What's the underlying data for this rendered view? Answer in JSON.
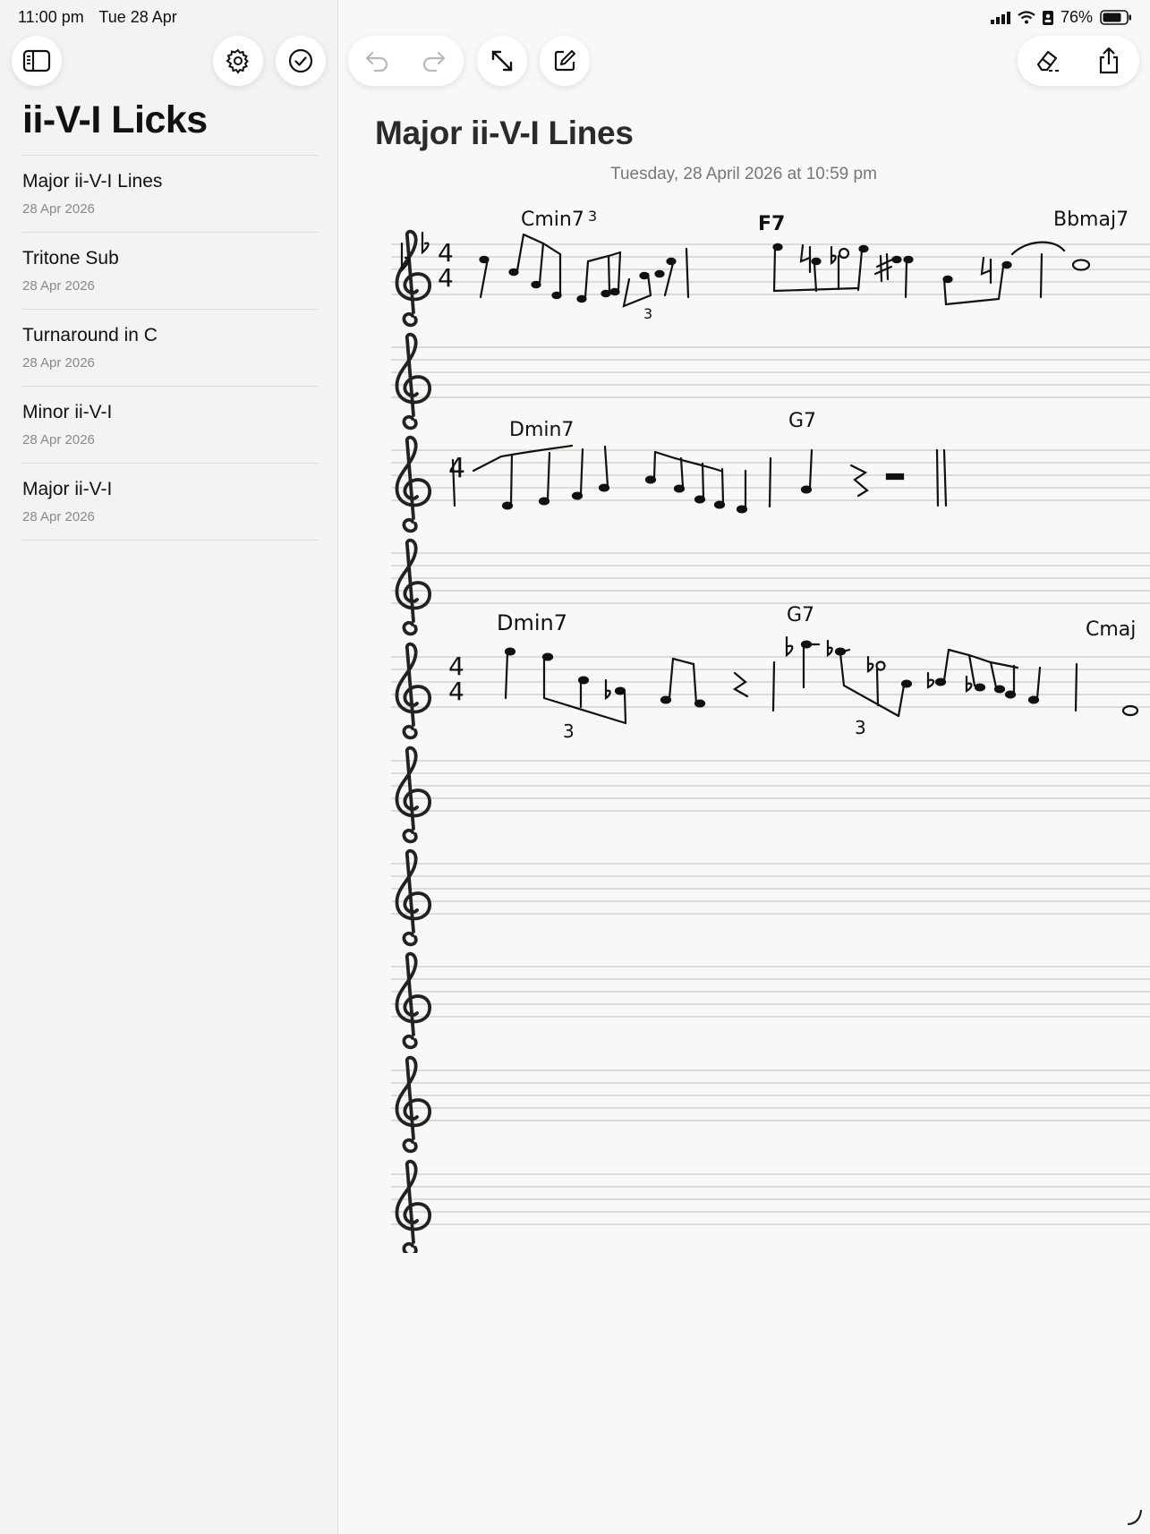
{
  "status_bar": {
    "time": "11:00 pm",
    "date": "Tue 28 Apr",
    "battery": "76%"
  },
  "sidebar": {
    "folder_title": "ii-V-I Licks",
    "notes": [
      {
        "title": "Major ii-V-I Lines",
        "date": "28 Apr 2026"
      },
      {
        "title": "Tritone Sub",
        "date": "28 Apr 2026"
      },
      {
        "title": "Turnaround in C",
        "date": "28 Apr 2026"
      },
      {
        "title": "Minor ii-V-I",
        "date": "28 Apr 2026"
      },
      {
        "title": "Major ii-V-I",
        "date": "28 Apr 2026"
      }
    ]
  },
  "note": {
    "title": "Major ii-V-I Lines",
    "timestamp": "Tuesday, 28 April 2026 at 10:59 pm",
    "chords": {
      "line1": [
        "Cmin7",
        "F7",
        "Bbmaj7"
      ],
      "line2": [
        "Dmin7",
        "G7"
      ],
      "line3": [
        "Dmin7",
        "G7",
        "Cmaj"
      ]
    },
    "triplet_label": "3",
    "time_signature": "4"
  },
  "icons": {
    "sidebar_toggle": "sidebar-icon",
    "settings": "gear-icon",
    "checklist": "checkmark-circle-icon",
    "undo": "undo-icon",
    "redo": "redo-icon",
    "fullscreen": "expand-icon",
    "compose": "compose-icon",
    "eraser": "eraser-icon",
    "share": "share-icon"
  },
  "colors": {
    "background": "#f8f8f6",
    "sidebar": "#f3f3f1",
    "ink": "#111111",
    "staff_lines": "#c9c9c6"
  }
}
